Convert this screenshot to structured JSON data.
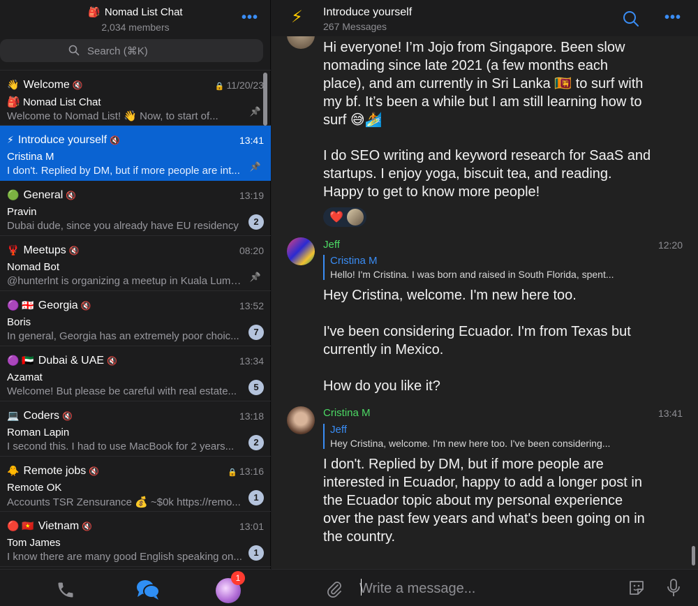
{
  "sidebar": {
    "title": "Nomad List Chat",
    "title_emoji": "🎒",
    "members": "2,034 members",
    "more": "•••",
    "search_placeholder": "Search (⌘K)",
    "chats": [
      {
        "emoji": "👋",
        "title": "Welcome",
        "time": "11/20/23",
        "sender": "🎒 Nomad List Chat",
        "preview": "Welcome to Nomad List!  👋 Now, to start of...",
        "pinned": true,
        "locked": true
      },
      {
        "emoji": "⚡",
        "title": "Introduce yourself",
        "time": "13:41",
        "sender": "Cristina M",
        "preview": "I don't. Replied by DM, but if more people are int...",
        "pinned": true,
        "active": true
      },
      {
        "emoji": "🟢",
        "title": "General",
        "time": "13:19",
        "sender": "Pravin",
        "preview": "Dubai dude, since you already have EU residency",
        "badge": "2"
      },
      {
        "emoji": "🦞",
        "title": "Meetups",
        "time": "08:20",
        "sender": "Nomad Bot",
        "preview": "@hunterlnt is organizing a meetup in Kuala Lump...",
        "pinned": true
      },
      {
        "emoji": "🟣 🇬🇪",
        "title": "Georgia",
        "time": "13:52",
        "sender": "Boris",
        "preview": "In general, Georgia has an extremely poor choic...",
        "badge": "7"
      },
      {
        "emoji": "🟣 🇦🇪",
        "title": "Dubai & UAE",
        "time": "13:34",
        "sender": "Azamat",
        "preview": "Welcome! But please be careful with real estate...",
        "badge": "5"
      },
      {
        "emoji": "💻",
        "title": "Coders",
        "time": "13:18",
        "sender": "Roman Lapin",
        "preview": "I second this. I had to use MacBook for 2 years...",
        "badge": "2"
      },
      {
        "emoji": "🐥",
        "title": "Remote jobs",
        "time": "13:16",
        "sender": "Remote OK",
        "preview": "Accounts TSR Zensurance  💰 ~$0k https://remo...",
        "badge": "1",
        "locked": true
      },
      {
        "emoji": "🔴 🇻🇳",
        "title": "Vietnam",
        "time": "13:01",
        "sender": "Tom James",
        "preview": "I know there are many good English speaking on...",
        "badge": "1"
      }
    ]
  },
  "tabbar": {
    "profile_badge": "1"
  },
  "conversation": {
    "title": "Introduce yourself",
    "subtitle": "267 Messages",
    "more": "•••",
    "messages": [
      {
        "text": "Hi everyone! I’m Jojo from Singapore. Been slow nomading since late 2021 (a few months each place), and am currently in Sri Lanka 🇱🇰 to surf with my bf. It’s been a while but I am still learning how to surf 😅🏄",
        "text2": "I do SEO writing and keyword research for SaaS and startups. I enjoy yoga, biscuit tea, and reading. Happy to get to know more people!",
        "reaction": "❤️"
      },
      {
        "author": "Jeff",
        "time": "12:20",
        "reply_name": "Cristina M",
        "reply_text": "Hello! I'm Cristina. I was born and raised in South Florida, spent...",
        "text": "Hey Cristina, welcome. I'm new here too.",
        "text2": "I've been considering Ecuador. I'm from Texas but currently in Mexico.",
        "text3": "How do you like it?"
      },
      {
        "author": "Cristina M",
        "time": "13:41",
        "reply_name": "Jeff",
        "reply_text": "Hey Cristina, welcome. I'm new here too.  I've been considering...",
        "text": "I don't. Replied by DM, but if more people are interested in Ecuador, happy to add a longer post in the Ecuador topic about my personal experience over the past few years and what's been going on in the country."
      }
    ]
  },
  "composer": {
    "placeholder": "Write a message..."
  },
  "colors": {
    "accent": "#3a8df5",
    "active_row": "#0a63d2",
    "author_name": "#4cd964",
    "badge": "#b4c3dc",
    "notification": "#ff3b30"
  }
}
